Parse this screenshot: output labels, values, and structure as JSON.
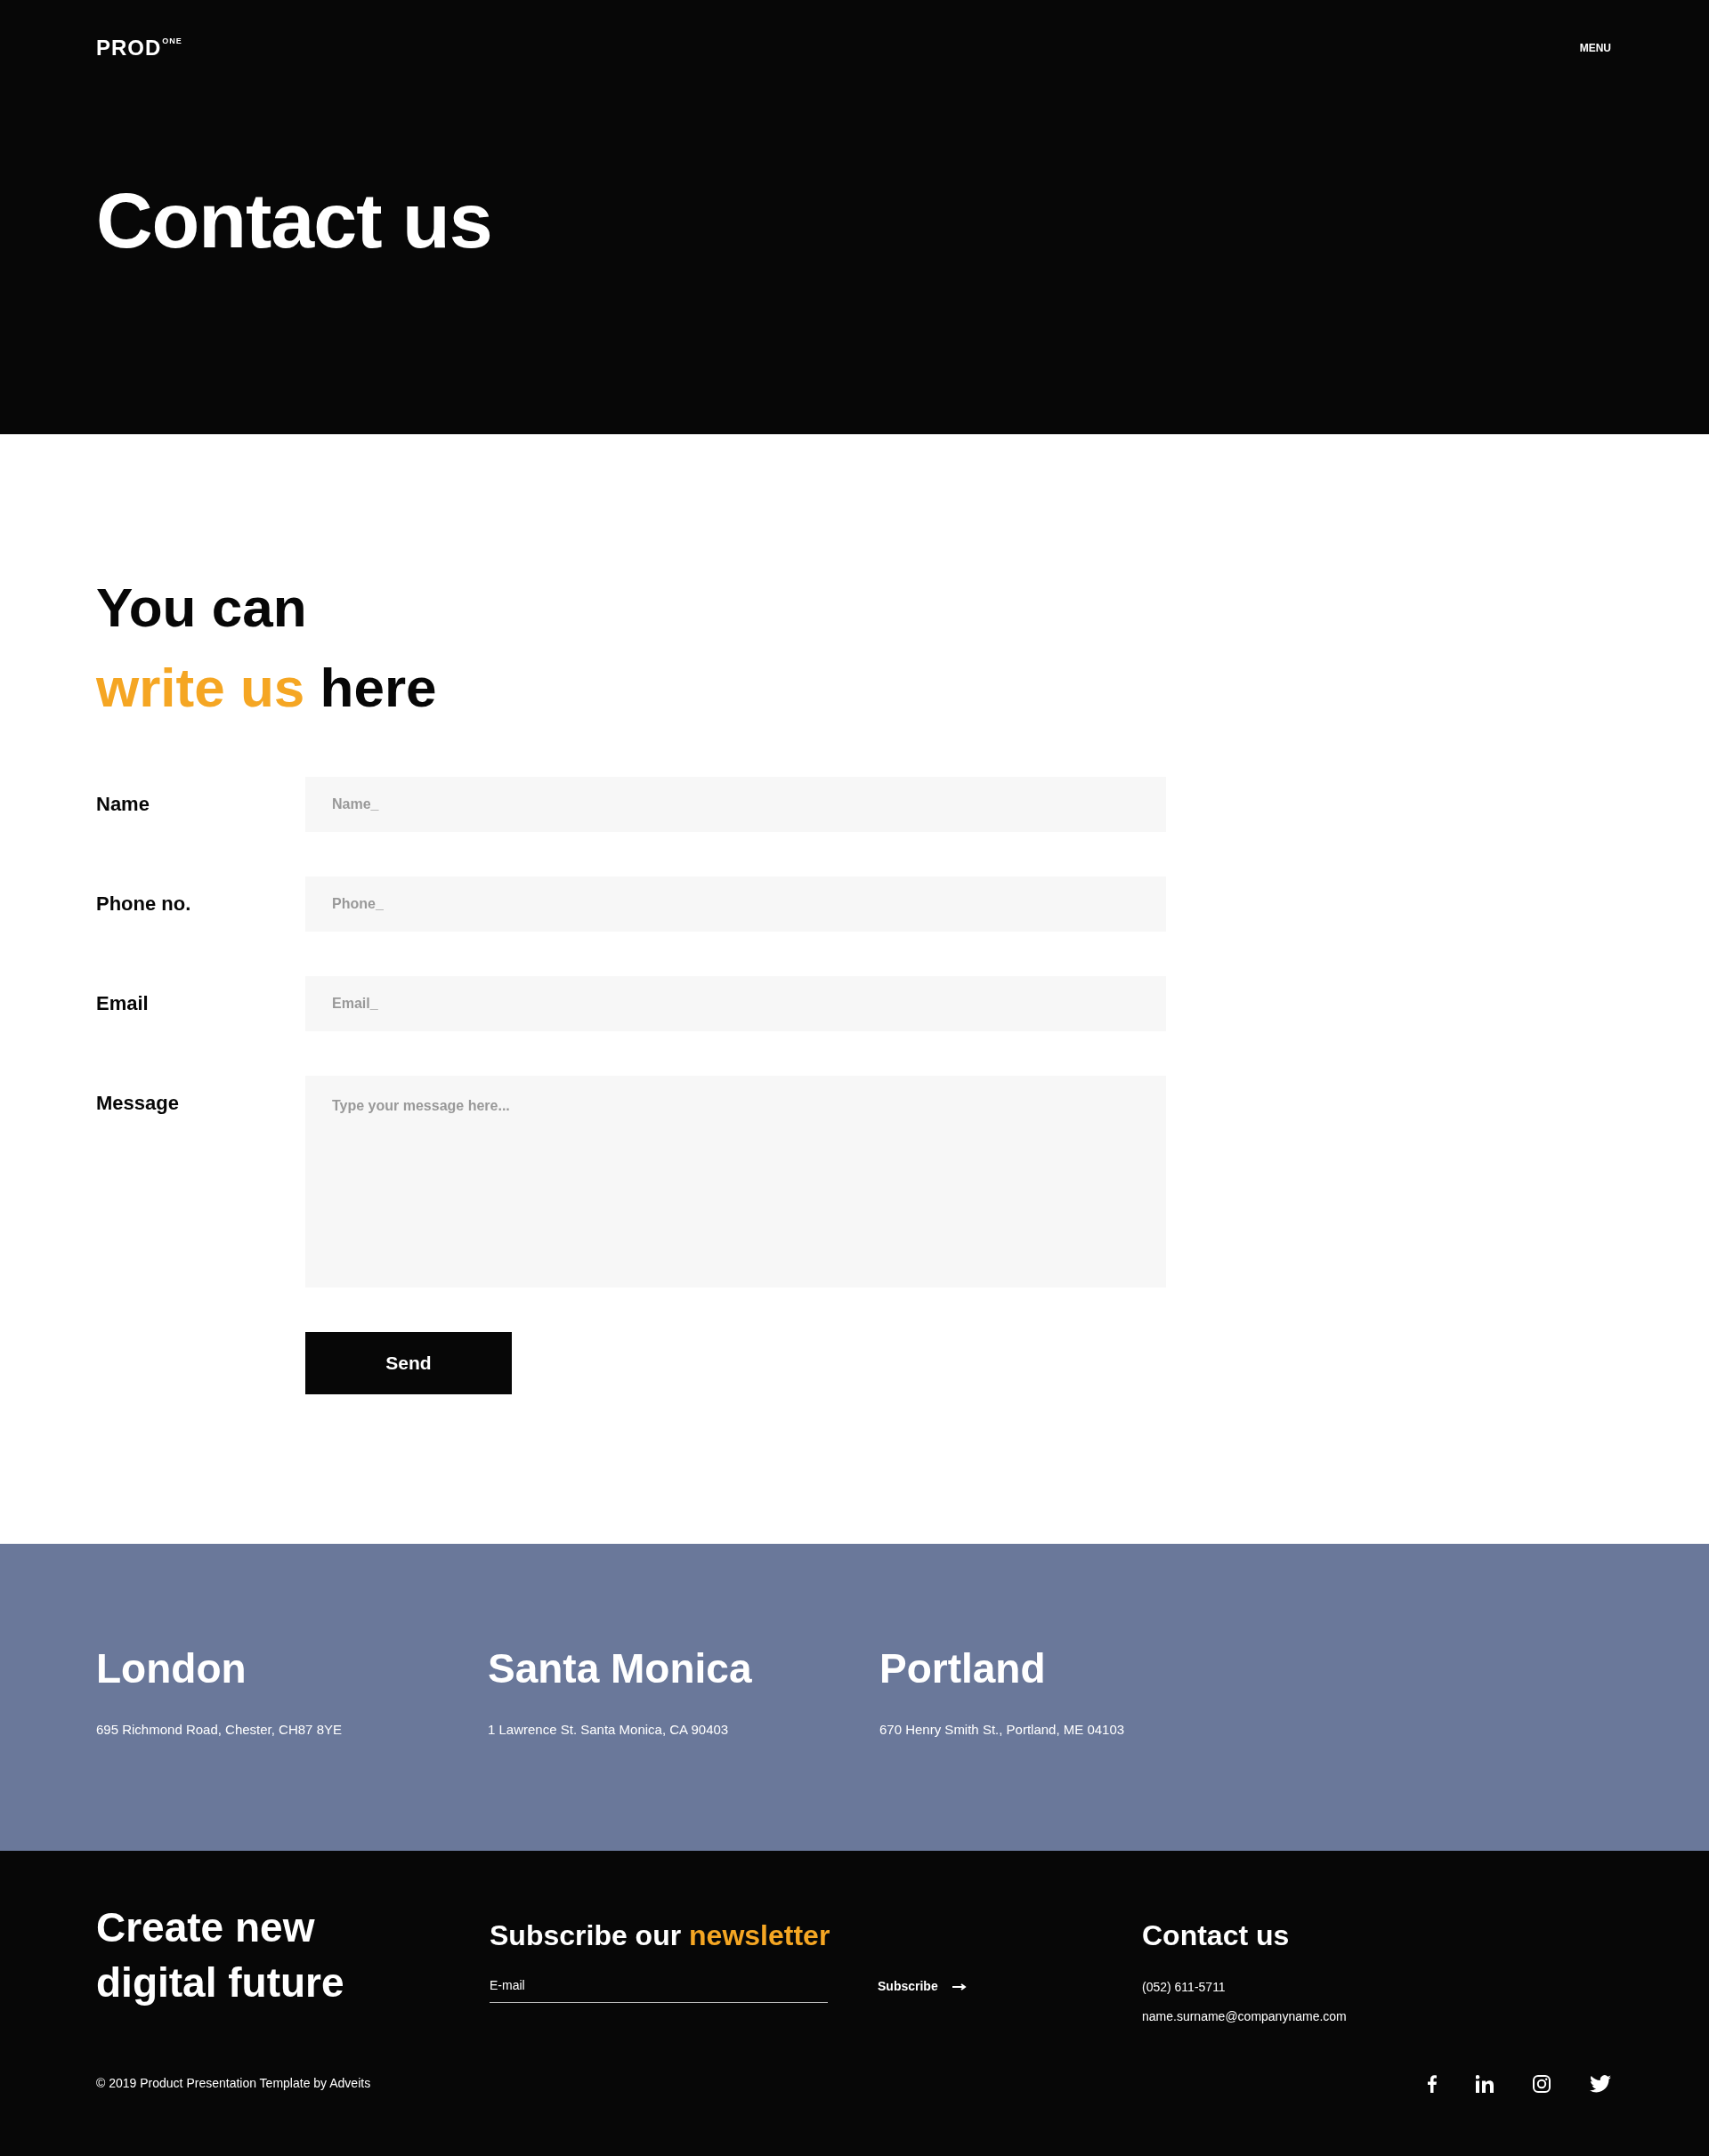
{
  "header": {
    "logo": "PROD",
    "logo_sup": "ONE",
    "menu": "MENU",
    "title": "Contact us"
  },
  "intro": {
    "line1": "You can",
    "highlight": "write us",
    "rest": "here"
  },
  "form": {
    "fields": [
      {
        "label": "Name",
        "placeholder": "Name_",
        "kind": "input"
      },
      {
        "label": "Phone no.",
        "placeholder": "Phone_",
        "kind": "input"
      },
      {
        "label": "Email",
        "placeholder": "Email_",
        "kind": "input"
      },
      {
        "label": "Message",
        "placeholder": "Type your message here...",
        "kind": "textarea"
      }
    ],
    "submit": "Send"
  },
  "offices": [
    {
      "city": "London",
      "address": "695 Richmond Road, Chester, CH87 8YE"
    },
    {
      "city": "Santa Monica",
      "address": "1 Lawrence St. Santa Monica, CA 90403"
    },
    {
      "city": "Portland",
      "address": "670 Henry Smith St., Portland, ME 04103"
    }
  ],
  "footer": {
    "slogan": [
      "Create new",
      "digital future"
    ],
    "newsletter": {
      "text": "Subscribe our",
      "highlight": "newsletter",
      "placeholder": "E-mail",
      "button": "Subscribe"
    },
    "contact": {
      "title": "Contact us",
      "phone": "(052) 611-5711",
      "email": "name.surname@companyname.com"
    },
    "copyright": "© 2019 Product Presentation Template by Adveits"
  }
}
